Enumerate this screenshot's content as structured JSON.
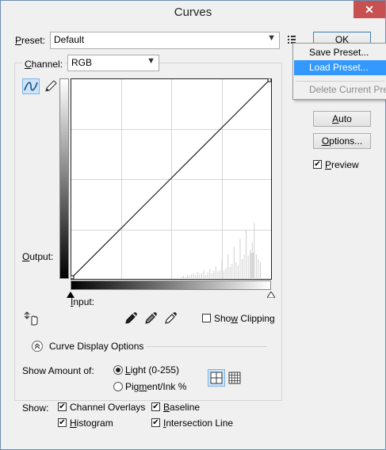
{
  "window": {
    "title": "Curves",
    "close_glyph": "✕"
  },
  "preset": {
    "label": "Preset:",
    "value": "Default"
  },
  "channel": {
    "label": "Channel:",
    "value": "RGB"
  },
  "buttons": {
    "ok": "OK",
    "auto": "Auto",
    "options": "Options..."
  },
  "preview": {
    "label": "Preview",
    "checked": true
  },
  "preset_menu": {
    "items": [
      {
        "label": "Save Preset...",
        "state": "normal"
      },
      {
        "label": "Load Preset...",
        "state": "highlighted"
      },
      {
        "label": "Delete Current Preset",
        "state": "disabled"
      }
    ]
  },
  "graph": {
    "output_label": "Output:",
    "input_label": "Input:",
    "curve_from": [
      0,
      0
    ],
    "curve_to": [
      255,
      255
    ],
    "grid_divisions": 4
  },
  "show_clipping": {
    "label": "Show Clipping",
    "checked": false
  },
  "curve_display": {
    "title": "Curve Display Options",
    "show_amount_label": "Show Amount of:",
    "light_label": "Light  (0-255)",
    "pigment_label": "Pigment/Ink %",
    "selected": "light",
    "show_label": "Show:",
    "checkboxes": {
      "channel_overlays": "Channel Overlays",
      "baseline": "Baseline",
      "histogram": "Histogram",
      "intersection_line": "Intersection Line"
    }
  },
  "icons": [
    "curve-tool-icon",
    "pencil-icon",
    "target-adjust-icon",
    "black-eyedropper-icon",
    "gray-eyedropper-icon",
    "white-eyedropper-icon",
    "grid-simple-icon",
    "grid-detailed-icon",
    "preset-options-icon",
    "collapse-icon"
  ],
  "colors": {
    "highlight": "#3399ff",
    "close": "#c75050",
    "selected_tool": "#cce4f7"
  }
}
